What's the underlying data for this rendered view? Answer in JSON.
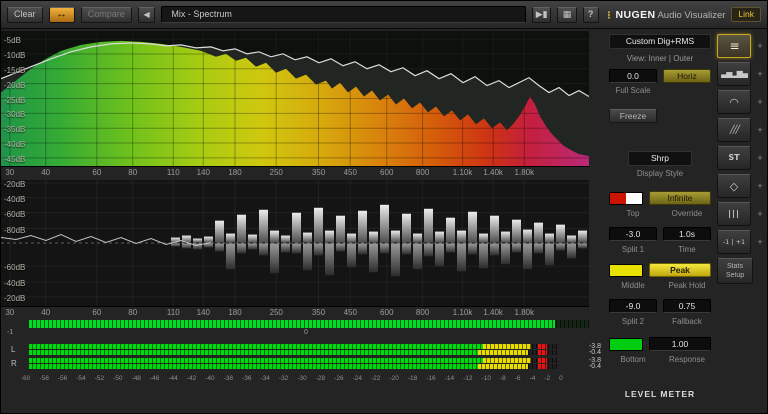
{
  "toolbar": {
    "clear": "Clear",
    "ab_icon": "↔",
    "compare": "Compare",
    "prev_icon": "◀",
    "preset": "Mix - Spectrum",
    "play_icon": "▶▮",
    "keys_icon": "▦",
    "help": "?",
    "logo": {
      "dots": "⋮",
      "brand": "NUGEN",
      "suffix": "Audio Visualizer"
    },
    "link": "Link"
  },
  "freq_ticks": [
    {
      "label": "30",
      "pos": 1.5
    },
    {
      "label": "40",
      "pos": 7.6
    },
    {
      "label": "60",
      "pos": 16.3
    },
    {
      "label": "80",
      "pos": 22.4
    },
    {
      "label": "110",
      "pos": 29.3
    },
    {
      "label": "140",
      "pos": 34.4
    },
    {
      "label": "180",
      "pos": 39.8
    },
    {
      "label": "250",
      "pos": 46.8
    },
    {
      "label": "350",
      "pos": 54.0
    },
    {
      "label": "450",
      "pos": 59.4
    },
    {
      "label": "600",
      "pos": 65.6
    },
    {
      "label": "800",
      "pos": 71.7
    },
    {
      "label": "1.10k",
      "pos": 78.5
    },
    {
      "label": "1.40k",
      "pos": 83.7
    },
    {
      "label": "1.80k",
      "pos": 89.0
    }
  ],
  "spectrum_panel": {
    "db_ticks": [
      {
        "label": "-5dB",
        "pos": 6
      },
      {
        "label": "-10dB",
        "pos": 17
      },
      {
        "label": "-15dB",
        "pos": 28
      },
      {
        "label": "-20dB",
        "pos": 39
      },
      {
        "label": "-25dB",
        "pos": 50
      },
      {
        "label": "-30dB",
        "pos": 61
      },
      {
        "label": "-35dB",
        "pos": 72
      },
      {
        "label": "-40dB",
        "pos": 83
      },
      {
        "label": "-45dB",
        "pos": 94
      }
    ],
    "gradient": [
      {
        "off": 0,
        "color": "#1f9448"
      },
      {
        "off": 10,
        "color": "#35ab35"
      },
      {
        "off": 22,
        "color": "#6fc11c"
      },
      {
        "off": 34,
        "color": "#a8cc12"
      },
      {
        "off": 44,
        "color": "#cfc80e"
      },
      {
        "off": 54,
        "color": "#d6ab0d"
      },
      {
        "off": 64,
        "color": "#d9850c"
      },
      {
        "off": 74,
        "color": "#d55c0b"
      },
      {
        "off": 83,
        "color": "#cd3313"
      },
      {
        "off": 90,
        "color": "#c41f3e"
      },
      {
        "off": 100,
        "color": "#bb2a78"
      }
    ],
    "fill_points": [
      [
        0,
        62
      ],
      [
        10,
        54
      ],
      [
        20,
        46
      ],
      [
        30,
        38
      ],
      [
        45,
        28
      ],
      [
        60,
        20
      ],
      [
        80,
        14
      ],
      [
        100,
        11
      ],
      [
        120,
        10
      ],
      [
        140,
        11
      ],
      [
        160,
        13
      ],
      [
        180,
        16
      ],
      [
        200,
        20
      ],
      [
        215,
        26
      ],
      [
        225,
        23
      ],
      [
        235,
        30
      ],
      [
        245,
        27
      ],
      [
        255,
        36
      ],
      [
        265,
        32
      ],
      [
        275,
        42
      ],
      [
        285,
        38
      ],
      [
        295,
        48
      ],
      [
        305,
        44
      ],
      [
        315,
        54
      ],
      [
        325,
        50
      ],
      [
        331,
        58
      ],
      [
        339,
        52
      ],
      [
        347,
        62
      ],
      [
        355,
        56
      ],
      [
        363,
        66
      ],
      [
        371,
        60
      ],
      [
        379,
        70
      ],
      [
        387,
        64
      ],
      [
        395,
        74
      ],
      [
        403,
        68
      ],
      [
        411,
        78
      ],
      [
        419,
        72
      ],
      [
        427,
        82
      ],
      [
        435,
        76
      ],
      [
        443,
        86
      ],
      [
        451,
        80
      ],
      [
        459,
        90
      ],
      [
        467,
        84
      ],
      [
        475,
        94
      ],
      [
        483,
        88
      ],
      [
        491,
        98
      ],
      [
        499,
        92
      ],
      [
        506,
        100
      ],
      [
        512,
        94
      ],
      [
        518,
        86
      ],
      [
        524,
        76
      ],
      [
        529,
        66
      ],
      [
        534,
        74
      ],
      [
        539,
        86
      ],
      [
        545,
        96
      ],
      [
        551,
        104
      ],
      [
        557,
        110
      ],
      [
        563,
        116
      ],
      [
        570,
        120
      ],
      [
        578,
        124
      ],
      [
        588,
        126
      ],
      [
        588,
        136
      ],
      [
        0,
        136
      ]
    ],
    "line_points": [
      [
        0,
        48
      ],
      [
        15,
        42
      ],
      [
        30,
        36
      ],
      [
        50,
        28
      ],
      [
        70,
        21
      ],
      [
        90,
        16
      ],
      [
        110,
        13
      ],
      [
        130,
        12
      ],
      [
        150,
        13
      ],
      [
        165,
        15
      ],
      [
        180,
        14
      ],
      [
        195,
        17
      ],
      [
        210,
        16
      ],
      [
        222,
        20
      ],
      [
        234,
        18
      ],
      [
        246,
        23
      ],
      [
        258,
        21
      ],
      [
        270,
        26
      ],
      [
        282,
        23
      ],
      [
        294,
        29
      ],
      [
        306,
        26
      ],
      [
        318,
        32
      ],
      [
        330,
        28
      ],
      [
        342,
        35
      ],
      [
        354,
        31
      ],
      [
        366,
        38
      ],
      [
        378,
        34
      ],
      [
        390,
        41
      ],
      [
        402,
        37
      ],
      [
        414,
        45
      ],
      [
        426,
        40
      ],
      [
        438,
        48
      ],
      [
        450,
        43
      ],
      [
        462,
        52
      ],
      [
        474,
        46
      ],
      [
        486,
        55
      ],
      [
        498,
        50
      ],
      [
        508,
        57
      ],
      [
        518,
        52
      ],
      [
        528,
        47
      ],
      [
        538,
        55
      ],
      [
        548,
        62
      ],
      [
        558,
        57
      ],
      [
        568,
        65
      ],
      [
        578,
        60
      ],
      [
        588,
        66
      ]
    ]
  },
  "diff_panel": {
    "db_ticks": [
      {
        "label": "-20dB",
        "pos": 2.4
      },
      {
        "label": "-40dB",
        "pos": 14.2
      },
      {
        "label": "-60dB",
        "pos": 26
      },
      {
        "label": "-80dB",
        "pos": 38.6
      },
      {
        "label": "-60dB",
        "pos": 68.5
      },
      {
        "label": "-40dB",
        "pos": 81
      },
      {
        "label": "-20dB",
        "pos": 92.9
      }
    ],
    "bars": [
      [
        170,
        5,
        3
      ],
      [
        181,
        7,
        5
      ],
      [
        192,
        4,
        6
      ],
      [
        203,
        6,
        4
      ],
      [
        214,
        22,
        8
      ],
      [
        225,
        9,
        26
      ],
      [
        236,
        28,
        10
      ],
      [
        247,
        8,
        6
      ],
      [
        258,
        33,
        12
      ],
      [
        269,
        12,
        30
      ],
      [
        280,
        7,
        9
      ],
      [
        291,
        30,
        10
      ],
      [
        302,
        10,
        27
      ],
      [
        313,
        35,
        12
      ],
      [
        324,
        12,
        32
      ],
      [
        335,
        27,
        8
      ],
      [
        346,
        9,
        24
      ],
      [
        357,
        32,
        11
      ],
      [
        368,
        11,
        29
      ],
      [
        379,
        38,
        10
      ],
      [
        390,
        12,
        33
      ],
      [
        401,
        29,
        11
      ],
      [
        412,
        9,
        26
      ],
      [
        423,
        34,
        13
      ],
      [
        434,
        11,
        23
      ],
      [
        445,
        25,
        9
      ],
      [
        456,
        12,
        28
      ],
      [
        467,
        31,
        11
      ],
      [
        478,
        9,
        25
      ],
      [
        489,
        27,
        12
      ],
      [
        500,
        11,
        21
      ],
      [
        511,
        23,
        9
      ],
      [
        522,
        13,
        26
      ],
      [
        533,
        20,
        10
      ],
      [
        544,
        9,
        22
      ],
      [
        555,
        18,
        7
      ],
      [
        566,
        7,
        15
      ],
      [
        577,
        12,
        5
      ]
    ],
    "trace_points": [
      [
        0,
        58
      ],
      [
        15,
        60
      ],
      [
        30,
        56
      ],
      [
        45,
        61
      ],
      [
        60,
        55
      ],
      [
        75,
        62
      ],
      [
        90,
        57
      ],
      [
        105,
        63
      ],
      [
        120,
        58
      ],
      [
        135,
        64
      ],
      [
        150,
        59
      ],
      [
        165,
        65
      ],
      [
        180,
        61
      ],
      [
        195,
        66
      ],
      [
        210,
        63
      ]
    ]
  },
  "correlation": {
    "lit_pct": 94,
    "neg_label": "-1",
    "zero_label": "0"
  },
  "level_meter": {
    "title": "LEVEL METER",
    "channels": [
      {
        "name": "L",
        "strips": [
          {
            "green": 86,
            "yellow": 95,
            "hold": 96.4
          },
          {
            "green": 85,
            "yellow": 94.5,
            "hold": 96.4
          }
        ],
        "readouts": [
          "-3.8",
          "-0.4"
        ]
      },
      {
        "name": "R",
        "strips": [
          {
            "green": 86,
            "yellow": 95,
            "hold": 96.4
          },
          {
            "green": 85,
            "yellow": 94.5,
            "hold": 96.4
          }
        ],
        "readouts": [
          "-3.8",
          "-0.4"
        ]
      }
    ],
    "scale": [
      "-60",
      "-58",
      "-56",
      "-54",
      "-52",
      "-50",
      "-48",
      "-46",
      "-44",
      "-42",
      "-40",
      "-38",
      "-36",
      "-34",
      "-32",
      "-30",
      "-28",
      "-26",
      "-24",
      "-22",
      "-20",
      "-18",
      "-16",
      "-14",
      "-12",
      "-10",
      "-8",
      "-6",
      "-4",
      "-2",
      "0"
    ]
  },
  "controls": {
    "preset": "Custom Dig+RMS",
    "view_label": "View: Inner | Outer",
    "scale_value": "0.0",
    "horiz": "Horiz",
    "full_scale_label": "Full Scale",
    "freeze": "Freeze",
    "display_style_value": "Shrp",
    "display_style_label": "Display Style",
    "top_swatch": [
      "#cc1400",
      "#ffffff"
    ],
    "infinite": "Infinite",
    "top_label": "Top",
    "override_label": "Override",
    "split1_value": "-3.0",
    "time_value": "1.0s",
    "split1_label": "Split 1",
    "time_label": "Time",
    "middle_swatch": "#e8e000",
    "peak": "Peak",
    "middle_label": "Middle",
    "peak_hold_label": "Peak Hold",
    "split2_value": "-9.0",
    "fallback_value": "0.75",
    "split2_label": "Split 2",
    "fallback_label": "Fallback",
    "bottom_swatch": "#00cc10",
    "response_value": "1.00",
    "bottom_label": "Bottom",
    "response_label": "Response"
  },
  "mode_strip": {
    "add_icon": "+",
    "stats": [
      "Stats",
      "Setup"
    ],
    "buttons": [
      {
        "name": "level-meter",
        "glyph": "≡",
        "selected": true
      },
      {
        "name": "spectrum-bars",
        "glyph": "▃▅▂▆▄"
      },
      {
        "name": "spectrum-curve",
        "glyph": "◠"
      },
      {
        "name": "spectrogram",
        "glyph": "╱╱╱"
      },
      {
        "name": "stereo-spectrum",
        "glyph": "ST"
      },
      {
        "name": "vectorscope",
        "glyph": "◇"
      },
      {
        "name": "multiband",
        "glyph": "|||"
      },
      {
        "name": "correlation",
        "glyph": "-1 | +1"
      }
    ]
  }
}
